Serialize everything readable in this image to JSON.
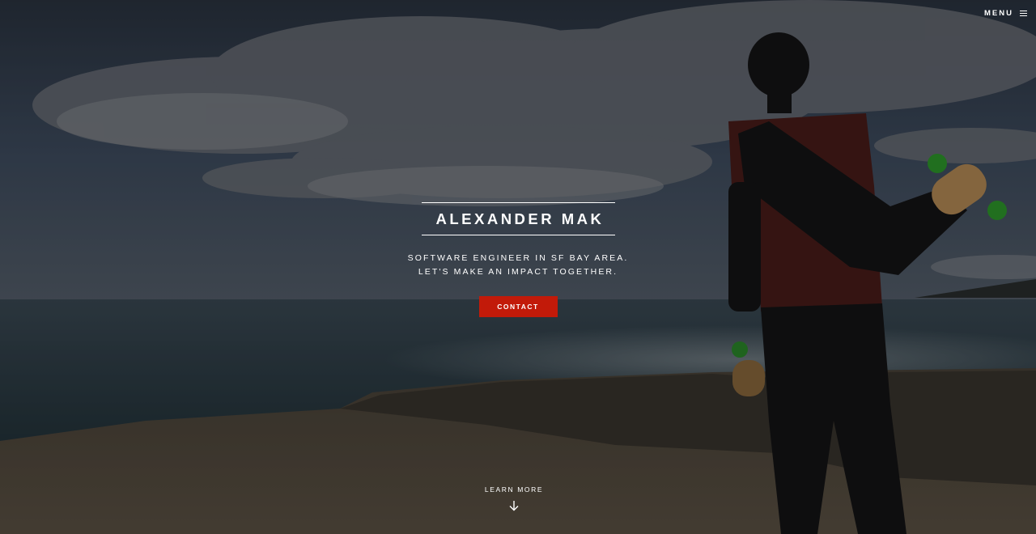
{
  "nav": {
    "menu_label": "MENU",
    "menu_icon": "hamburger-icon"
  },
  "hero": {
    "title": "ALEXANDER MAK",
    "tagline_line1": "SOFTWARE ENGINEER IN SF BAY AREA.",
    "tagline_line2": "LET'S MAKE AN IMPACT TOGETHER.",
    "contact_label": "CONTACT",
    "learn_more_label": "LEARN MORE",
    "learn_more_icon": "arrow-down-icon",
    "background_image": "photo of a person holding a longboard on coastal rocks by the ocean under a cloudy sky"
  },
  "colors": {
    "accent": "#c21a09",
    "text": "#ffffff"
  }
}
